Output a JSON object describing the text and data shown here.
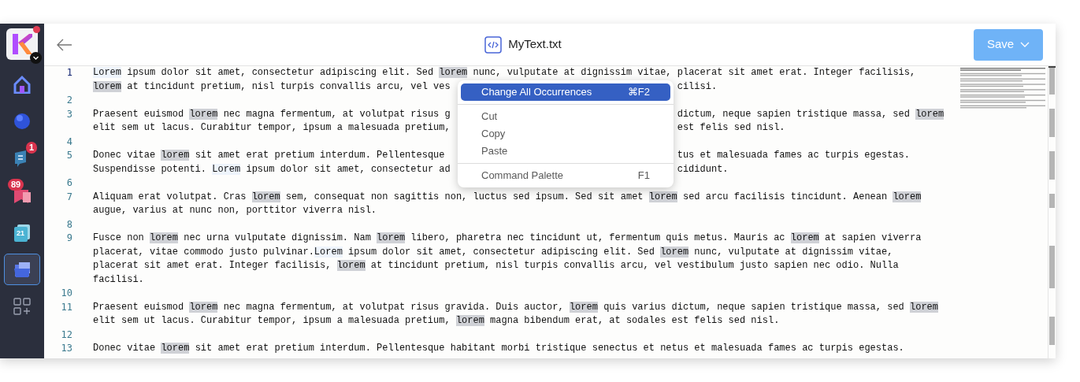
{
  "app_switcher": {
    "notification": true
  },
  "sidebar": {
    "items": [
      {
        "kind": "home",
        "selected": false
      },
      {
        "kind": "sphere",
        "selected": false
      },
      {
        "kind": "chat",
        "badge": "1",
        "selected": false
      },
      {
        "kind": "mail",
        "badge": "89",
        "selected": false
      },
      {
        "kind": "calendar",
        "day": "21",
        "selected": false
      },
      {
        "kind": "drive",
        "selected": true
      }
    ]
  },
  "header": {
    "title": "MyText.txt",
    "save_button": "Save"
  },
  "editor": {
    "lines": [
      {
        "number": "1",
        "current": true,
        "rows": [
          {
            "parts": [
              {
                "text": "Lorem",
                "kind": "related"
              },
              {
                "text": " ipsum dolor sit amet, consectetur adipiscing elit. Sed "
              },
              {
                "text": "lorem",
                "kind": "match"
              },
              {
                "text": " nunc, vulputate at dignissim vitae, placerat sit amet erat. Integer facilisis,"
              }
            ]
          },
          {
            "left": [
              {
                "text": "lorem",
                "kind": "match"
              },
              {
                "text": " at tincidunt pretium, nisl turpis convallis arcu, vel ves"
              }
            ],
            "right": [
              {
                "text": "cilisi."
              }
            ]
          }
        ]
      },
      {
        "number": "2",
        "current": false
      },
      {
        "number": "3",
        "current": false,
        "rows": [
          {
            "left": [
              {
                "text": "Praesent euismod "
              },
              {
                "text": "lorem",
                "kind": "match"
              },
              {
                "text": " nec magna fermentum, at volutpat risus g"
              }
            ],
            "right": [
              {
                "text": "dictum, neque sapien tristique massa, sed "
              },
              {
                "text": "lorem",
                "kind": "match"
              }
            ]
          },
          {
            "left": [
              {
                "text": "elit sem ut lacus. Curabitur tempor, ipsum a malesuada pretium,"
              }
            ],
            "right": [
              {
                "text": "est felis sed nisl."
              }
            ]
          }
        ]
      },
      {
        "number": "4",
        "current": false
      },
      {
        "number": "5",
        "current": false,
        "rows": [
          {
            "left": [
              {
                "text": "Donec vitae "
              },
              {
                "text": "lorem",
                "kind": "match"
              },
              {
                "text": " sit amet erat pretium interdum. Pellentesque"
              }
            ],
            "right": [
              {
                "text": "tus et malesuada fames ac turpis egestas."
              }
            ]
          },
          {
            "left": [
              {
                "text": "Suspendisse potenti. "
              },
              {
                "text": "Lorem",
                "kind": "related"
              },
              {
                "text": " ipsum dolor sit amet, consectetur ad"
              }
            ],
            "right": [
              {
                "text": "cididunt."
              }
            ]
          }
        ]
      },
      {
        "number": "6",
        "current": false
      },
      {
        "number": "7",
        "current": false,
        "rows": [
          {
            "parts": [
              {
                "text": "Aliquam erat volutpat. Cras "
              },
              {
                "text": "lorem",
                "kind": "match"
              },
              {
                "text": " sem, consequat non sagittis non, luctus sed ipsum. Sed sit amet "
              },
              {
                "text": "lorem",
                "kind": "match"
              },
              {
                "text": " sed arcu facilisis tincidunt. Aenean "
              },
              {
                "text": "lorem",
                "kind": "match"
              }
            ]
          },
          {
            "parts": [
              {
                "text": "augue, varius at nunc non, porttitor viverra nisl."
              }
            ]
          }
        ]
      },
      {
        "number": "8",
        "current": false
      },
      {
        "number": "9",
        "current": false,
        "rows": [
          {
            "parts": [
              {
                "text": "Fusce non "
              },
              {
                "text": "lorem",
                "kind": "match"
              },
              {
                "text": " nec urna vulputate dignissim. Nam "
              },
              {
                "text": "lorem",
                "kind": "match"
              },
              {
                "text": " libero, pharetra nec tincidunt ut, fermentum quis metus. Mauris ac "
              },
              {
                "text": "lorem",
                "kind": "match"
              },
              {
                "text": " at sapien viverra"
              }
            ]
          },
          {
            "parts": [
              {
                "text": "placerat, vitae commodo justo pulvinar."
              },
              {
                "text": "Lorem",
                "kind": "related"
              },
              {
                "text": " ipsum dolor sit amet, consectetur adipiscing elit. Sed "
              },
              {
                "text": "lorem",
                "kind": "match"
              },
              {
                "text": " nunc, vulputate at dignissim vitae,"
              }
            ]
          },
          {
            "parts": [
              {
                "text": "placerat sit amet erat. Integer facilisis, "
              },
              {
                "text": "lorem",
                "kind": "match"
              },
              {
                "text": " at tincidunt pretium, nisl turpis convallis arcu, vel vestibulum justo sapien nec odio. Nulla"
              }
            ]
          },
          {
            "parts": [
              {
                "text": "facilisi."
              }
            ]
          }
        ]
      },
      {
        "number": "10",
        "current": false
      },
      {
        "number": "11",
        "current": false,
        "rows": [
          {
            "parts": [
              {
                "text": "Praesent euismod "
              },
              {
                "text": "lorem",
                "kind": "match"
              },
              {
                "text": " nec magna fermentum, at volutpat risus gravida. Duis auctor, "
              },
              {
                "text": "lorem",
                "kind": "match"
              },
              {
                "text": " quis varius dictum, neque sapien tristique massa, sed "
              },
              {
                "text": "lorem",
                "kind": "match"
              }
            ]
          },
          {
            "parts": [
              {
                "text": "elit sem ut lacus. Curabitur tempor, ipsum a malesuada pretium, "
              },
              {
                "text": "lorem",
                "kind": "match"
              },
              {
                "text": " magna bibendum erat, at sodales est felis sed nisl."
              }
            ]
          }
        ]
      },
      {
        "number": "12",
        "current": false
      },
      {
        "number": "13",
        "current": false,
        "rows": [
          {
            "parts": [
              {
                "text": "Donec vitae "
              },
              {
                "text": "lorem",
                "kind": "match"
              },
              {
                "text": " sit amet erat pretium interdum. Pellentesque habitant morbi tristique senectus et netus et malesuada fames ac turpis egestas."
              }
            ]
          }
        ]
      }
    ]
  },
  "context_menu": {
    "groups": [
      [
        {
          "label": "Change All Occurrences",
          "shortcut": "⌘F2",
          "selected": true
        }
      ],
      [
        {
          "label": "Cut",
          "selected": false
        },
        {
          "label": "Copy",
          "selected": false
        },
        {
          "label": "Paste",
          "selected": false
        }
      ],
      [
        {
          "label": "Command Palette",
          "shortcut": "F1",
          "selected": false
        }
      ]
    ]
  }
}
